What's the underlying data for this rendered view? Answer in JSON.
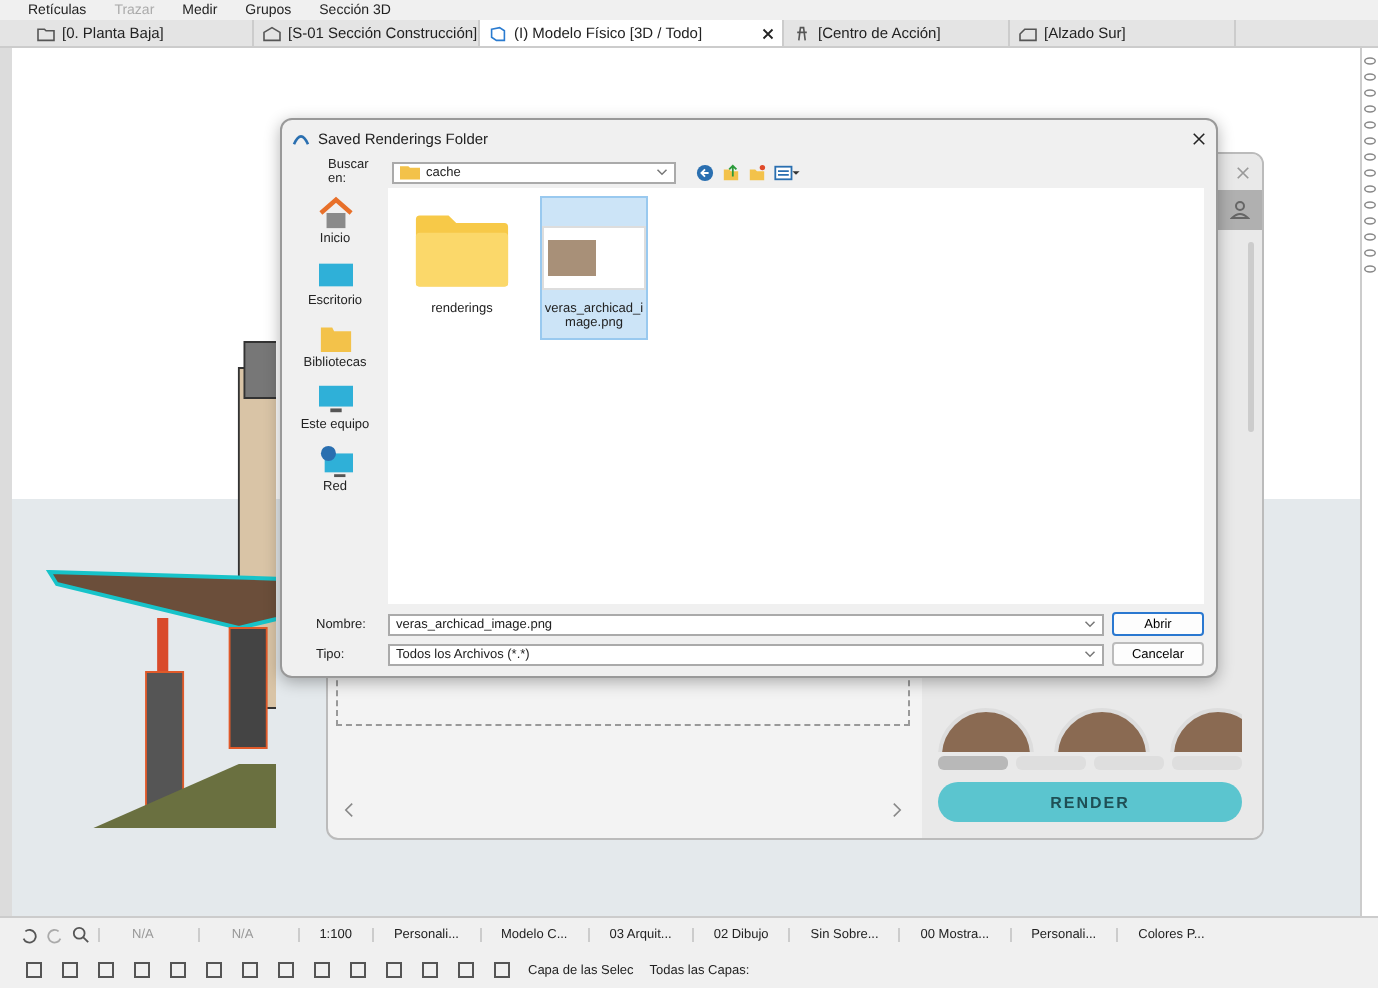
{
  "toolbar": {
    "items": [
      {
        "label": "Retículas",
        "disabled": false
      },
      {
        "label": "Trazar",
        "disabled": true
      },
      {
        "label": "Medir",
        "disabled": false
      },
      {
        "label": "Grupos",
        "disabled": false
      },
      {
        "label": "Sección 3D",
        "disabled": false
      }
    ]
  },
  "view_tabs": [
    {
      "label": "[0. Planta Baja]",
      "kind": "plan",
      "selected": false
    },
    {
      "label": "[S-01 Sección Construcción]",
      "kind": "section",
      "selected": false
    },
    {
      "label": "(I) Modelo Físico [3D / Todo]",
      "kind": "model",
      "selected": true
    },
    {
      "label": "[Centro de Acción]",
      "kind": "action",
      "selected": false
    },
    {
      "label": "[Alzado Sur]",
      "kind": "elevation",
      "selected": false
    }
  ],
  "dialog": {
    "title": "Saved Renderings Folder",
    "look_in_label": "Buscar en:",
    "look_in_value": "cache",
    "places": [
      {
        "label": "Inicio",
        "kind": "home"
      },
      {
        "label": "Escritorio",
        "kind": "desktop"
      },
      {
        "label": "Bibliotecas",
        "kind": "libraries"
      },
      {
        "label": "Este equipo",
        "kind": "computer"
      },
      {
        "label": "Red",
        "kind": "network"
      }
    ],
    "files": [
      {
        "name": "renderings",
        "kind": "folder",
        "selected": false
      },
      {
        "name": "veras_archicad_image.png",
        "kind": "image",
        "selected": true
      }
    ],
    "name_label": "Nombre:",
    "name_value": "veras_archicad_image.png",
    "type_label": "Tipo:",
    "type_value": "Todos los Archivos (*.*)",
    "buttons": [
      "Abrir",
      "Cancelar"
    ]
  },
  "plugin": {
    "render_button": "RENDER",
    "style_tabs": [
      {
        "selected": true
      },
      {
        "selected": false
      },
      {
        "selected": false
      },
      {
        "selected": false
      }
    ]
  },
  "status_bar": {
    "zoom_values": [
      "N/A",
      "N/A"
    ],
    "scale": "1:100",
    "fields": [
      "Personali...",
      "Modelo C...",
      "03 Arquit...",
      "02 Dibujo",
      "Sin Sobre...",
      "00 Mostra...",
      "Personali...",
      "Colores P..."
    ]
  },
  "layer_bar": {
    "labels": [
      "Capa de las Selec",
      "Todas las Capas:"
    ]
  }
}
